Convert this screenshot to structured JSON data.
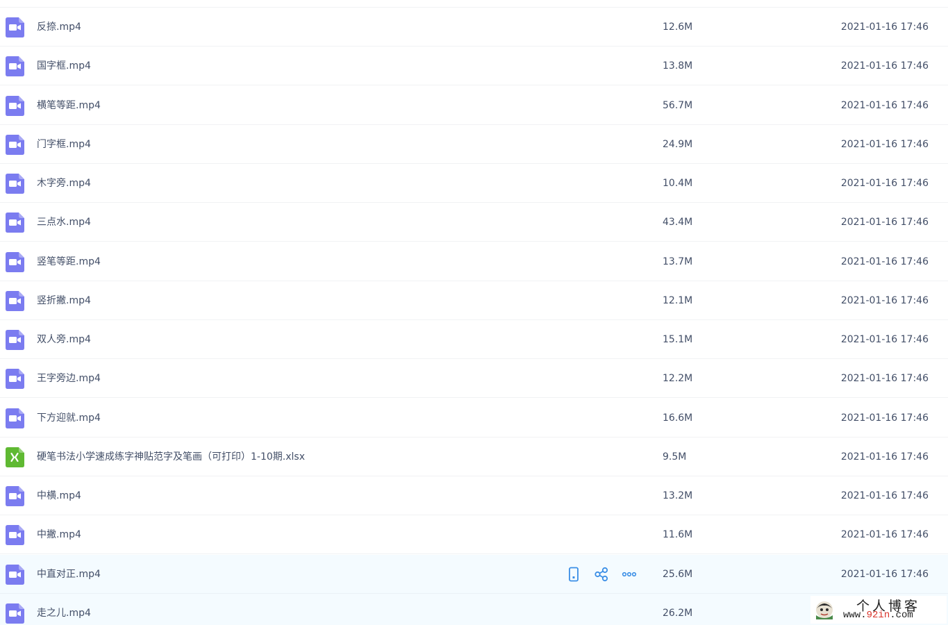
{
  "files": [
    {
      "name": "反捺.mp4",
      "size": "12.6M",
      "date": "2021-01-16 17:46",
      "type": "video"
    },
    {
      "name": "国字框.mp4",
      "size": "13.8M",
      "date": "2021-01-16 17:46",
      "type": "video"
    },
    {
      "name": "横笔等距.mp4",
      "size": "56.7M",
      "date": "2021-01-16 17:46",
      "type": "video"
    },
    {
      "name": "门字框.mp4",
      "size": "24.9M",
      "date": "2021-01-16 17:46",
      "type": "video"
    },
    {
      "name": "木字旁.mp4",
      "size": "10.4M",
      "date": "2021-01-16 17:46",
      "type": "video"
    },
    {
      "name": "三点水.mp4",
      "size": "43.4M",
      "date": "2021-01-16 17:46",
      "type": "video"
    },
    {
      "name": "竖笔等距.mp4",
      "size": "13.7M",
      "date": "2021-01-16 17:46",
      "type": "video"
    },
    {
      "name": "竖折撇.mp4",
      "size": "12.1M",
      "date": "2021-01-16 17:46",
      "type": "video"
    },
    {
      "name": "双人旁.mp4",
      "size": "15.1M",
      "date": "2021-01-16 17:46",
      "type": "video"
    },
    {
      "name": "王字旁边.mp4",
      "size": "12.2M",
      "date": "2021-01-16 17:46",
      "type": "video"
    },
    {
      "name": "下方迎就.mp4",
      "size": "16.6M",
      "date": "2021-01-16 17:46",
      "type": "video"
    },
    {
      "name": "硬笔书法小学速成练字神贴范字及笔画（可打印）1-10期.xlsx",
      "size": "9.5M",
      "date": "2021-01-16 17:46",
      "type": "excel"
    },
    {
      "name": "中横.mp4",
      "size": "13.2M",
      "date": "2021-01-16 17:46",
      "type": "video"
    },
    {
      "name": "中撇.mp4",
      "size": "11.6M",
      "date": "2021-01-16 17:46",
      "type": "video"
    },
    {
      "name": "中直对正.mp4",
      "size": "25.6M",
      "date": "2021-01-16 17:46",
      "type": "video",
      "hovered": true
    },
    {
      "name": "走之儿.mp4",
      "size": "26.2M",
      "date": "",
      "type": "video"
    }
  ],
  "row_actions": [
    {
      "icon": "phone-icon"
    },
    {
      "icon": "share-icon"
    },
    {
      "icon": "more-icon"
    }
  ],
  "colors": {
    "video_icon": "#7b7cf0",
    "excel_icon": "#5fb932",
    "action_blue": "#3a8ee6",
    "hover_row": "#f4fbff"
  },
  "watermark": {
    "title": "个人博客",
    "url_prefix": "www.",
    "url_accent": "92in",
    "url_suffix": ".com"
  }
}
